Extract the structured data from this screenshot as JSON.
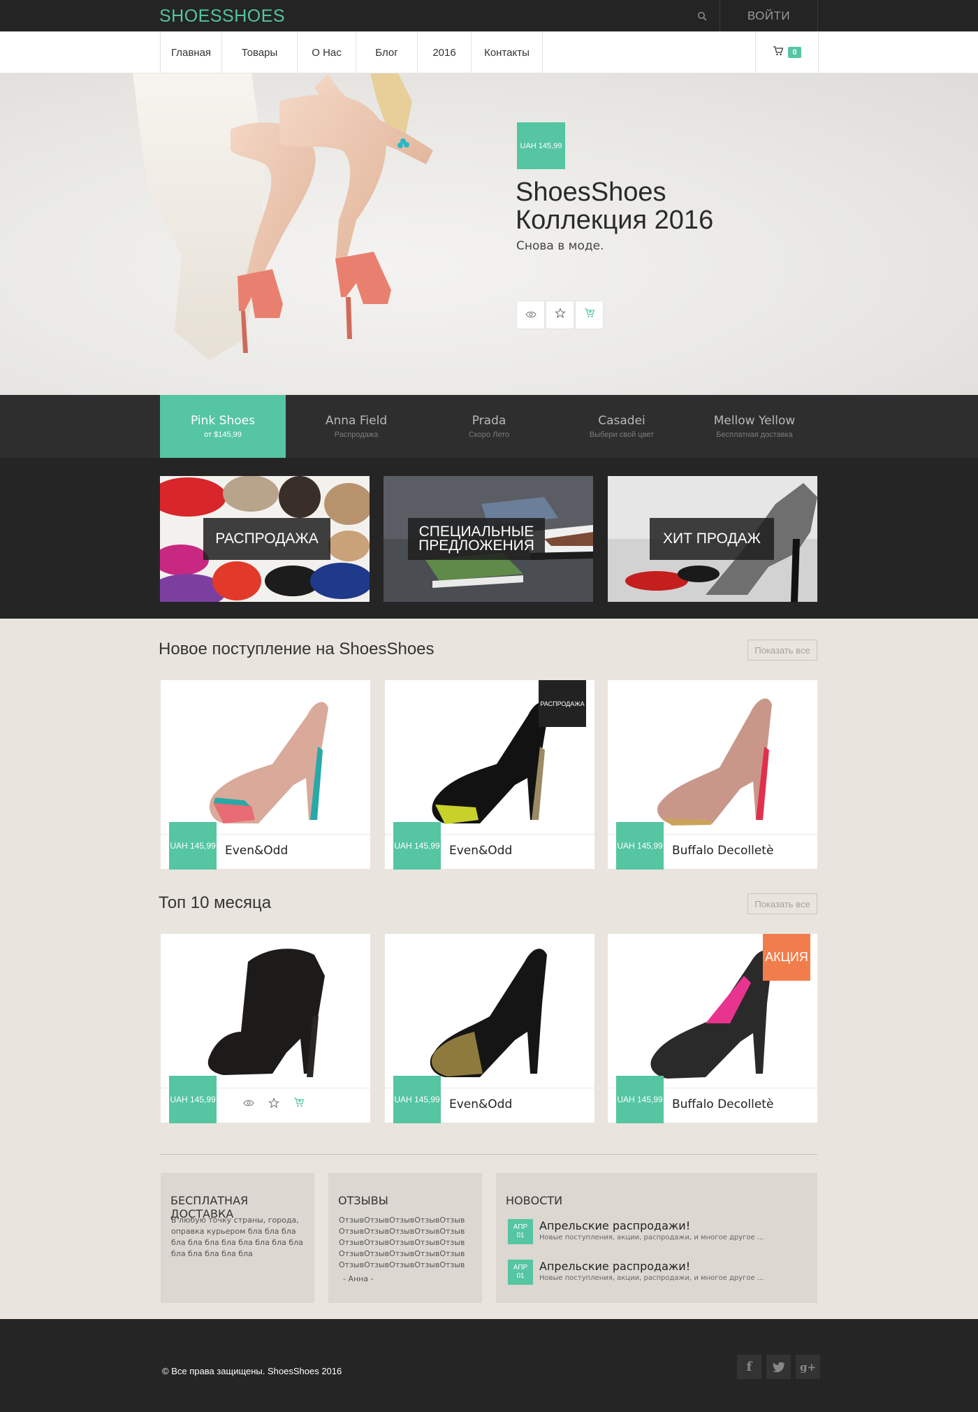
{
  "header": {
    "logo": "SHOESSHOES",
    "login": "ВОЙТИ"
  },
  "nav": {
    "items": [
      "Главная",
      "Товары",
      "О Нас",
      "Блог",
      "2016",
      "Контакты"
    ],
    "cart_count": "0"
  },
  "hero": {
    "price": "UAH 145,99",
    "title_line1": "ShoesShoes",
    "title_line2": "Коллекция 2016",
    "subtitle": "Снова в моде."
  },
  "tabs": [
    {
      "title": "Pink Shoes",
      "sub": "от $145,99",
      "active": true
    },
    {
      "title": "Anna Field",
      "sub": "Распродажа",
      "active": false
    },
    {
      "title": "Prada",
      "sub": "Скоро Лето",
      "active": false
    },
    {
      "title": "Casadei",
      "sub": "Выбери свой цвет",
      "active": false
    },
    {
      "title": "Mellow Yellow",
      "sub": "Бесплатная доставка",
      "active": false
    }
  ],
  "promos": [
    {
      "label": "РАСПРОДАЖА"
    },
    {
      "label_line1": "СПЕЦИАЛЬНЫЕ",
      "label_line2": "ПРЕДЛОЖЕНИЯ"
    },
    {
      "label": "ХИТ ПРОДАЖ"
    }
  ],
  "new_arrivals": {
    "title": "Новое поступление на ShoesShoes",
    "show_all": "Показать все",
    "products": [
      {
        "price": "UAH 145,99",
        "name": "Even&Odd"
      },
      {
        "price": "UAH 145,99",
        "name": "Even&Odd",
        "badge": "РАСПРОДАЖА"
      },
      {
        "price": "UAH 145,99",
        "name": "Buffalo Decolletè"
      }
    ]
  },
  "top10": {
    "title": "Топ 10 месяца",
    "show_all": "Показать все",
    "products": [
      {
        "price": "UAH 145,99",
        "name": ""
      },
      {
        "price": "UAH 145,99",
        "name": "Even&Odd"
      },
      {
        "price": "UAH 145,99",
        "name": "Buffalo Decolletè",
        "badge": "АКЦИЯ"
      }
    ]
  },
  "info": {
    "delivery_title": "БЕСПЛАТНАЯ ДОСТАВКА",
    "delivery_text": [
      "В любую точку страны, города,",
      "оправка курьером  бла бла бла",
      "бла бла бла бла бла бла бла бла",
      "бла бла бла бла бла"
    ],
    "reviews_title": "ОТЗЫВЫ",
    "reviews_text": [
      "ОтзывОтзывОтзывОтзывОтзыв",
      "ОтзывОтзывОтзывОтзывОтзыв",
      "ОтзывОтзывОтзывОтзывОтзыв",
      "ОтзывОтзывОтзывОтзывОтзыв",
      "ОтзывОтзывОтзывОтзывОтзыв"
    ],
    "reviews_author": "- Анна -",
    "news_title": "НОВОСТИ",
    "news": [
      {
        "month": "АПР",
        "day": "01",
        "head": "Апрельские распродажи!",
        "desc": "Новые поступления, акции, распродажи, и многое другое ..."
      },
      {
        "month": "АПР",
        "day": "01",
        "head": "Апрельские распродажи!",
        "desc": "Новые поступления, акции, распродажи, и многое другое ..."
      }
    ]
  },
  "footer": {
    "copyright": "© Все права защищены. ShoesShoes 2016",
    "socials": [
      "facebook-icon",
      "twitter-icon",
      "google-plus-icon"
    ]
  },
  "colors": {
    "accent": "#55c5a2",
    "dark": "#242424",
    "sale": "#f27d4c",
    "background": "#e9e5de"
  }
}
